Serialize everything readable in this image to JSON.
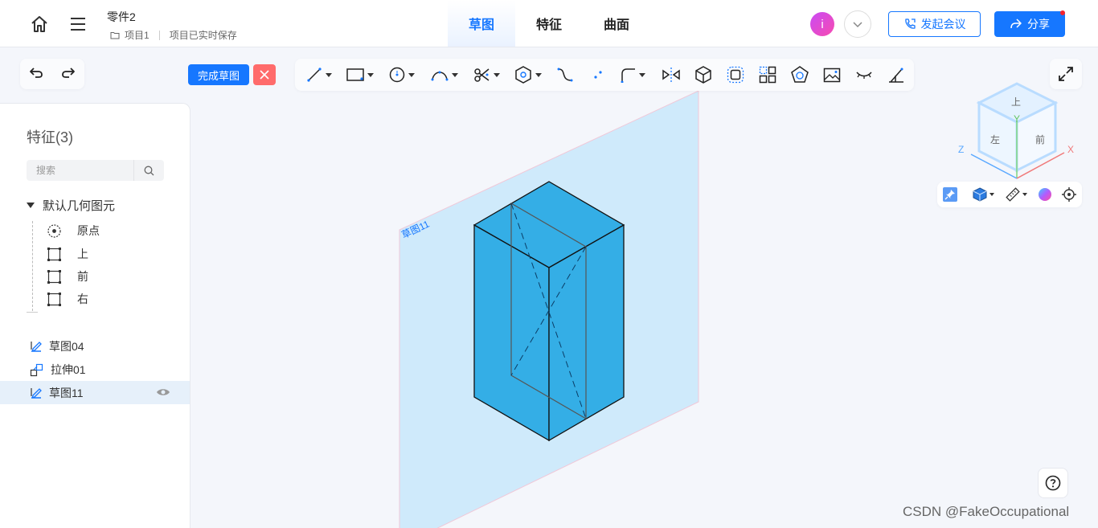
{
  "header": {
    "doc_title": "零件2",
    "project": "项目1",
    "save_status": "项目已实时保存",
    "tabs": [
      {
        "label": "草图",
        "active": true
      },
      {
        "label": "特征",
        "active": false
      },
      {
        "label": "曲面",
        "active": false
      }
    ],
    "avatar_letter": "i",
    "meeting_label": "发起会议",
    "share_label": "分享"
  },
  "sketch_actions": {
    "finish_label": "完成草图"
  },
  "toolbar": {
    "tools": [
      "line-tool-icon",
      "rectangle-tool-icon",
      "circle-tool-icon",
      "arc-tool-icon",
      "trim-tool-icon",
      "polygon-tool-icon",
      "spline-tool-icon",
      "point-tool-icon",
      "fillet-tool-icon",
      "mirror-tool-icon",
      "cube-tool-icon",
      "offset-tool-icon",
      "pattern-tool-icon",
      "shape-tool-icon",
      "image-tool-icon",
      "hide-tool-icon",
      "constraint-tool-icon"
    ]
  },
  "sidebar": {
    "title": "特征(3)",
    "search_placeholder": "搜索",
    "root_label": "默认几何图元",
    "children": [
      {
        "label": "原点",
        "icon": "origin-icon"
      },
      {
        "label": "上",
        "icon": "plane-icon"
      },
      {
        "label": "前",
        "icon": "plane-icon"
      },
      {
        "label": "右",
        "icon": "plane-icon"
      }
    ],
    "features": [
      {
        "label": "草图04",
        "icon": "sketch-icon",
        "selected": false
      },
      {
        "label": "拉伸01",
        "icon": "extrude-icon",
        "selected": false
      },
      {
        "label": "草图11",
        "icon": "sketch-icon",
        "selected": true
      }
    ]
  },
  "viewport": {
    "sketch_plane_label": "草图11"
  },
  "view_cube": {
    "top": "上",
    "left": "左",
    "front": "前",
    "axis_x": "X",
    "axis_y": "Y",
    "axis_z": "Z"
  },
  "watermark": "CSDN @FakeOccupational",
  "colors": {
    "accent": "#1677ff",
    "cancel": "#ff6b6b",
    "solid_fill": "#33aee6",
    "plane_fill": "#cfeafb"
  }
}
